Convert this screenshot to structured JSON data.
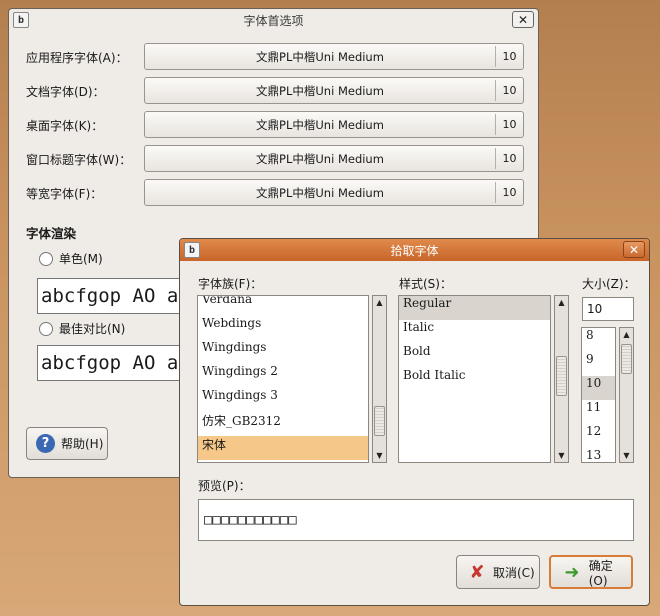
{
  "prefs_window": {
    "title": "字体首选项",
    "app_icon": "b",
    "close_icon": "✕",
    "rows": [
      {
        "label": "应用程序字体(A)：",
        "font": "文鼎PL中楷Uni Medium",
        "size": "10"
      },
      {
        "label": "文档字体(D)：",
        "font": "文鼎PL中楷Uni Medium",
        "size": "10"
      },
      {
        "label": "桌面字体(K)：",
        "font": "文鼎PL中楷Uni Medium",
        "size": "10"
      },
      {
        "label": "窗口标题字体(W)：",
        "font": "文鼎PL中楷Uni Medium",
        "size": "10"
      },
      {
        "label": "等宽字体(F)：",
        "font": "文鼎PL中楷Uni Medium",
        "size": "10"
      }
    ],
    "rendering_title": "字体渲染",
    "options": [
      {
        "label": "单色(M)",
        "preview": "abcfgop AO abcfgop"
      },
      {
        "label": "最佳对比(N)",
        "preview": "abcfgop AO abcfgop"
      }
    ],
    "help_label": "帮助(H)",
    "help_icon": "?"
  },
  "picker": {
    "title": "拾取字体",
    "app_icon": "b",
    "close_icon": "✕",
    "family_label": "字体族(F)：",
    "style_label": "样式(S)：",
    "size_label": "大小(Z)：",
    "families": [
      "Verdana",
      "Webdings",
      "Wingdings",
      "Wingdings 2",
      "Wingdings 3",
      "仿宋_GB2312",
      "宋体"
    ],
    "selected_family_index": 6,
    "styles": [
      "Regular",
      "Italic",
      "Bold",
      "Bold Italic"
    ],
    "selected_style_index": 0,
    "size_value": "10",
    "sizes": [
      "8",
      "9",
      "10",
      "11",
      "12",
      "13"
    ],
    "selected_size_index": 2,
    "preview_label": "预览(P)：",
    "preview_text": "□□□□□□□□□□□",
    "cancel_label": "取消(C)",
    "ok_label": "确定(O)",
    "up_arrow": "▲",
    "down_arrow": "▼"
  }
}
